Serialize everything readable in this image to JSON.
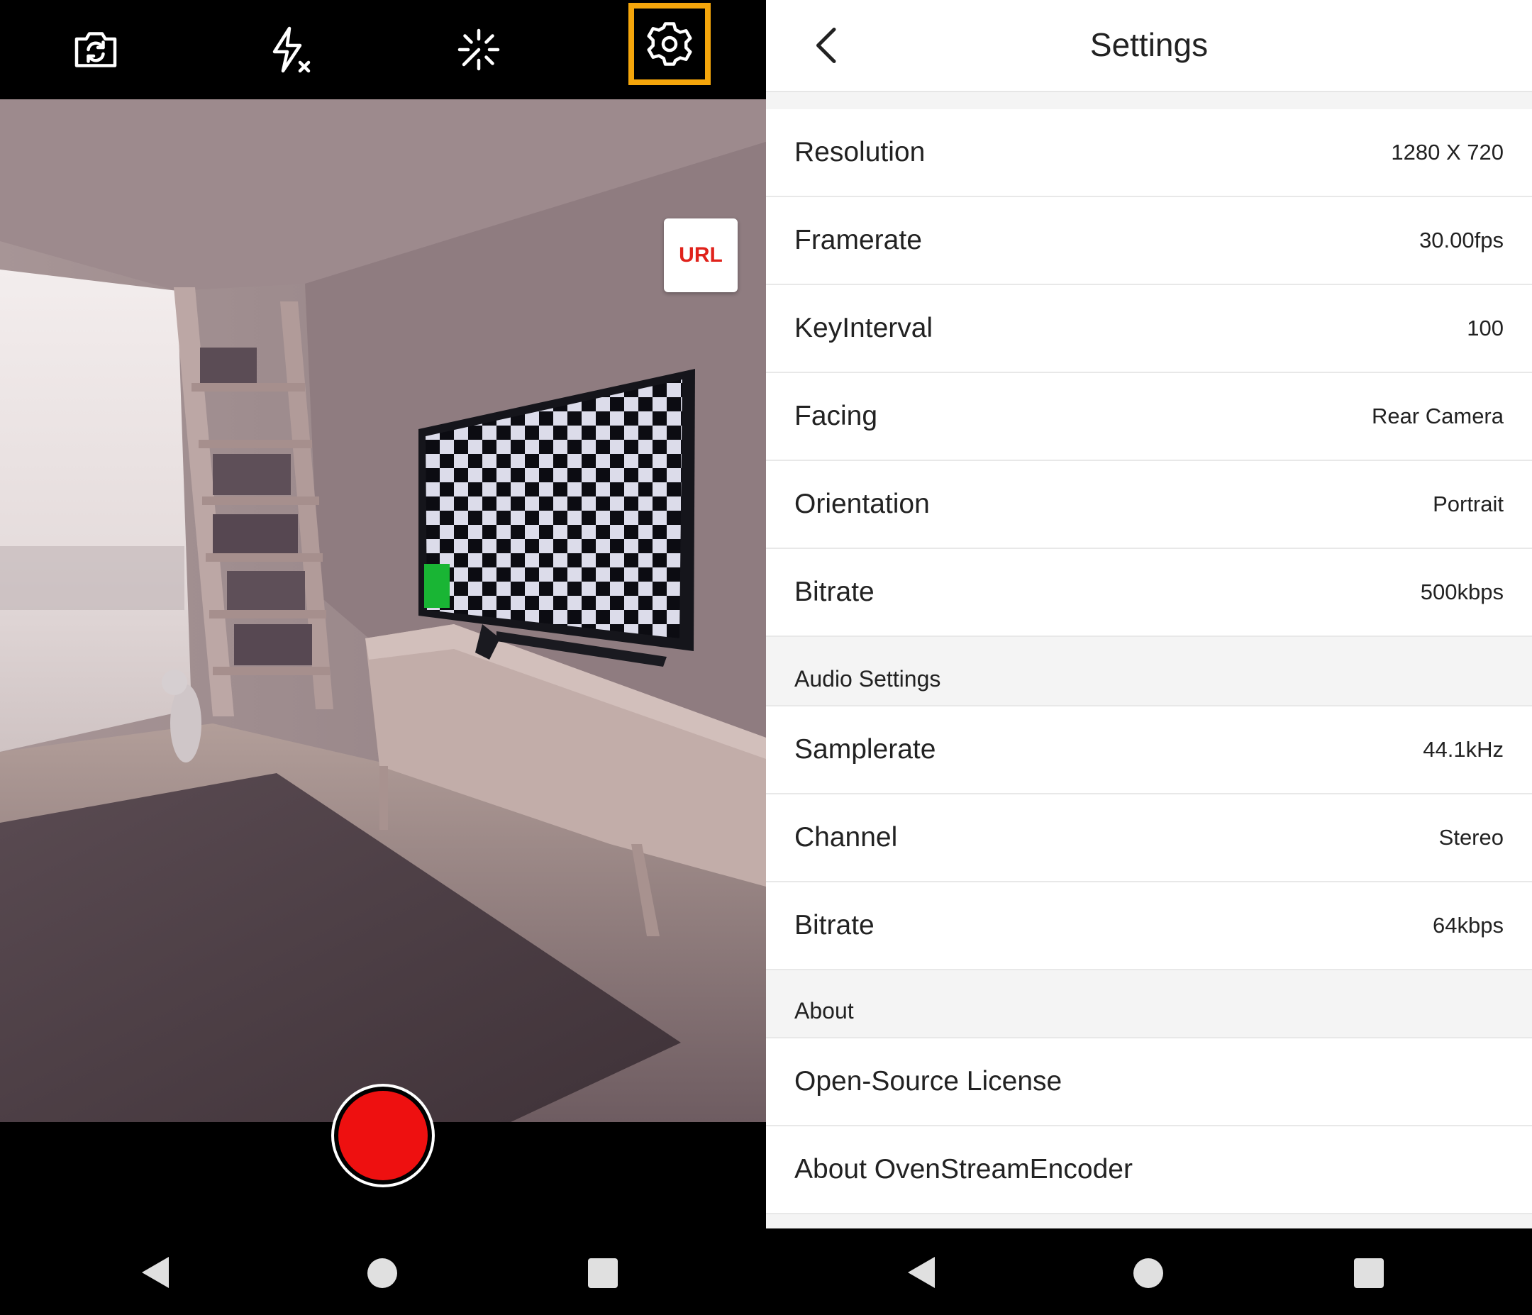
{
  "camera": {
    "icons": [
      "switch-camera-icon",
      "flash-off-icon",
      "filter-effect-icon",
      "settings-gear-icon"
    ],
    "url_button_label": "URL",
    "record_color": "#ee1010",
    "highlight_color": "#f5a60b"
  },
  "settings": {
    "title": "Settings",
    "video_rows": [
      {
        "label": "Resolution",
        "value": "1280 X 720"
      },
      {
        "label": "Framerate",
        "value": "30.00fps"
      },
      {
        "label": "KeyInterval",
        "value": "100"
      },
      {
        "label": "Facing",
        "value": "Rear Camera"
      },
      {
        "label": "Orientation",
        "value": "Portrait"
      },
      {
        "label": "Bitrate",
        "value": "500kbps"
      }
    ],
    "audio_header": "Audio Settings",
    "audio_rows": [
      {
        "label": "Samplerate",
        "value": "44.1kHz"
      },
      {
        "label": "Channel",
        "value": "Stereo"
      },
      {
        "label": "Bitrate",
        "value": "64kbps"
      }
    ],
    "about_header": "About",
    "about_rows": [
      {
        "label": "Open-Source License"
      },
      {
        "label": "About OvenStreamEncoder"
      }
    ]
  }
}
